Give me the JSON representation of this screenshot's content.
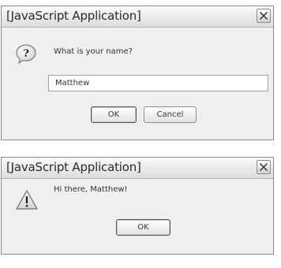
{
  "prompt_dialog": {
    "title": "[JavaScript Application]",
    "icon": "question-icon",
    "message": "What is your name?",
    "input_value": "Matthew",
    "ok_label": "OK",
    "cancel_label": "Cancel"
  },
  "alert_dialog": {
    "title": "[JavaScript Application]",
    "icon": "warning-icon",
    "message": "Hi there, Matthew!",
    "ok_label": "OK"
  },
  "colors": {
    "dialog_background": "#efefef",
    "border": "#8a8a8a",
    "text": "#333333"
  }
}
